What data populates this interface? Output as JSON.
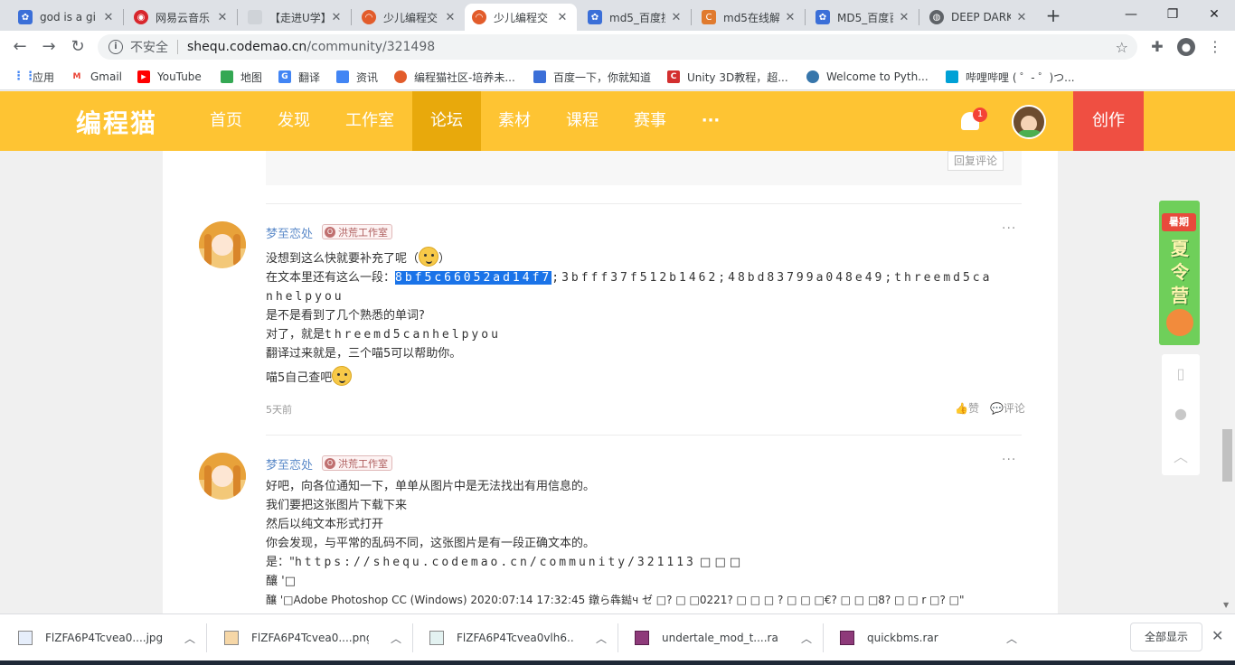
{
  "tabs": [
    {
      "title": "god is a gi",
      "icon": "paw-icon",
      "color": "#3b6fd8"
    },
    {
      "title": "网易云音乐",
      "icon": "netease-icon",
      "color": "#d8262c"
    },
    {
      "title": "【走进U学】",
      "icon": "page-icon",
      "color": "#9aa0a6"
    },
    {
      "title": "少儿编程交",
      "icon": "codemao-icon",
      "color": "#e25c2b"
    },
    {
      "title": "少儿编程交",
      "icon": "codemao-icon",
      "color": "#e25c2b"
    },
    {
      "title": "md5_百度搜",
      "icon": "paw-icon",
      "color": "#3b6fd8"
    },
    {
      "title": "md5在线解",
      "icon": "c-icon",
      "color": "#e07a2e"
    },
    {
      "title": "MD5_百度百",
      "icon": "paw-icon",
      "color": "#3b6fd8"
    },
    {
      "title": "DEEP DARK",
      "icon": "globe-icon",
      "color": "#5f6368"
    }
  ],
  "address": {
    "security": "不安全",
    "host": "shequ.codemao.cn",
    "path": "/community/321498"
  },
  "bookmarks": [
    {
      "label": "应用",
      "color": "#4285f4",
      "letter": ""
    },
    {
      "label": "Gmail",
      "color": "#ea4335",
      "letter": "M"
    },
    {
      "label": "YouTube",
      "color": "#ff0000",
      "letter": "▶"
    },
    {
      "label": "地图",
      "color": "#34a853",
      "letter": ""
    },
    {
      "label": "翻译",
      "color": "#4285f4",
      "letter": "G"
    },
    {
      "label": "资讯",
      "color": "#4285f4",
      "letter": ""
    },
    {
      "label": "编程猫社区-培养未...",
      "color": "#e25c2b",
      "letter": ""
    },
    {
      "label": "百度一下，你就知道",
      "color": "#3b6fd8",
      "letter": ""
    },
    {
      "label": "Unity 3D教程，超...",
      "color": "#d32f2f",
      "letter": "C"
    },
    {
      "label": "Welcome to Pyth...",
      "color": "#3776ab",
      "letter": ""
    },
    {
      "label": "哔哩哔哩 ( ゜- ゜)つ...",
      "color": "#00a1d6",
      "letter": ""
    }
  ],
  "site": {
    "logo": "编程猫",
    "nav": [
      "首页",
      "发现",
      "工作室",
      "论坛",
      "素材",
      "课程",
      "赛事",
      "···"
    ],
    "active_nav": "论坛",
    "notification_count": "1",
    "create_label": "创作"
  },
  "prev_reply": {
    "reply_label": "回复评论"
  },
  "posts": [
    {
      "username": "梦至恋处",
      "badge": "洪荒工作室",
      "badge_letter": "O",
      "more": "···",
      "lines": {
        "l1": "没想到这么快就要补充了呢（",
        "l1_end": "）",
        "l2_prefix": "在文本里还有这么一段：",
        "l2_selected": "8bf5c66052ad14f7",
        "l2_rest": ";3bfff37f512b1462;48bd83799a048e49;threemd5ca",
        "l3": "nhelpyou",
        "l4": "是不是看到了几个熟悉的单词?",
        "l5_prefix": "对了，就是",
        "l5_mono": "threemd5canhelpyou",
        "l6": "翻译过来就是，三个喵5可以帮助你。",
        "l7": "喵5自己查吧"
      },
      "time": "5天前",
      "like": "赞",
      "comment": "评论"
    },
    {
      "username": "梦至恋处",
      "badge": "洪荒工作室",
      "badge_letter": "O",
      "more": "···",
      "lines": {
        "l1": "好吧，向各位通知一下，单单从图片中是无法找出有用信息的。",
        "l2": "我们要把这张图片下载下来",
        "l3": "然后以纯文本形式打开",
        "l4": "你会发现，与平常的乱码不同，这张图片是有一段正确文本的。",
        "l5_prefix": "是：\"",
        "l5_mono": "https://shequ.codemao.cn/community/321113",
        "l5_tail": "□ □ □",
        "l6": "釀 '□",
        "l7": "釀 '□Adobe Photoshop CC (Windows) 2020:07:14 17:32:45 鐓ら犇鐑ч ゼ □? □ □0221? □ □ □ ? □ □ □€? □ □ □8? □ □ r □? □\""
      }
    }
  ],
  "downloads": [
    {
      "name": "FlZFA6P4Tcvea0....jpg",
      "icon": "image-file-icon"
    },
    {
      "name": "FlZFA6P4Tcvea0....png",
      "icon": "image-file-icon"
    },
    {
      "name": "FlZFA6P4Tcvea0vlh6...",
      "icon": "file-icon"
    },
    {
      "name": "undertale_mod_t....rar",
      "icon": "archive-icon"
    },
    {
      "name": "quickbms.rar",
      "icon": "archive-icon"
    }
  ],
  "show_all": "全部显示",
  "promo": {
    "tag": "暑期",
    "big": "夏令营"
  }
}
